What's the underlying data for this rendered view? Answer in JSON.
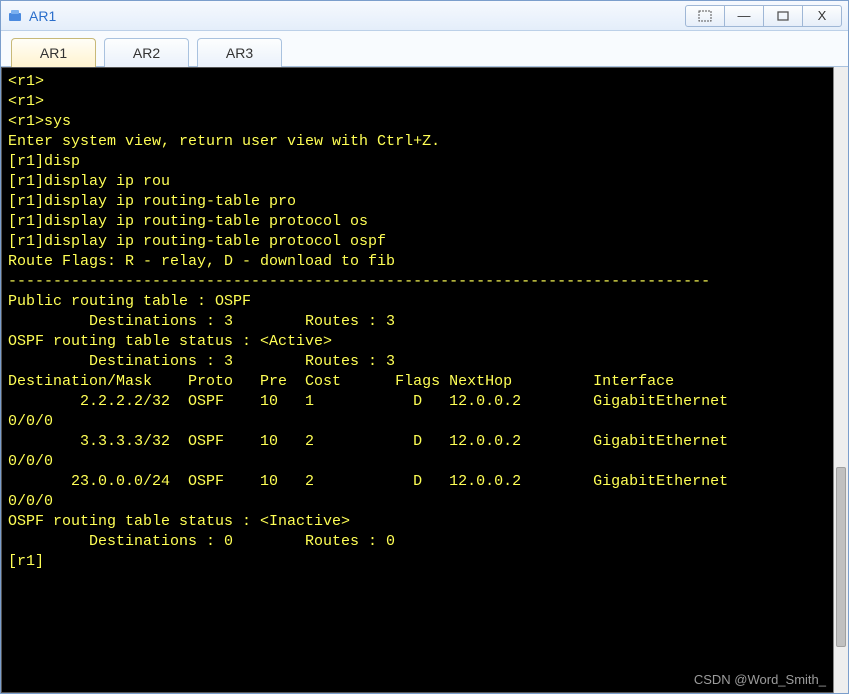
{
  "window": {
    "title": "AR1"
  },
  "tabs": [
    {
      "label": "AR1",
      "active": true
    },
    {
      "label": "AR2",
      "active": false
    },
    {
      "label": "AR3",
      "active": false
    }
  ],
  "terminal": {
    "lines": [
      "<r1>",
      "<r1>",
      "<r1>sys",
      "Enter system view, return user view with Ctrl+Z.",
      "[r1]disp",
      "[r1]display ip rou",
      "[r1]display ip routing-table pro",
      "[r1]display ip routing-table protocol os",
      "[r1]display ip routing-table protocol ospf",
      "Route Flags: R - relay, D - download to fib",
      "------------------------------------------------------------------------------",
      "Public routing table : OSPF",
      "         Destinations : 3        Routes : 3",
      "",
      "OSPF routing table status : <Active>",
      "         Destinations : 3        Routes : 3",
      "",
      "Destination/Mask    Proto   Pre  Cost      Flags NextHop         Interface",
      "",
      "        2.2.2.2/32  OSPF    10   1           D   12.0.0.2        GigabitEthernet",
      "0/0/0",
      "        3.3.3.3/32  OSPF    10   2           D   12.0.0.2        GigabitEthernet",
      "0/0/0",
      "       23.0.0.0/24  OSPF    10   2           D   12.0.0.2        GigabitEthernet",
      "0/0/0",
      "",
      "OSPF routing table status : <Inactive>",
      "         Destinations : 0        Routes : 0",
      "",
      "[r1]"
    ]
  },
  "watermark": "CSDN @Word_Smith_",
  "winbuttons": {
    "extra": "�⿺",
    "min": "—",
    "max": "▭",
    "close": "X"
  }
}
